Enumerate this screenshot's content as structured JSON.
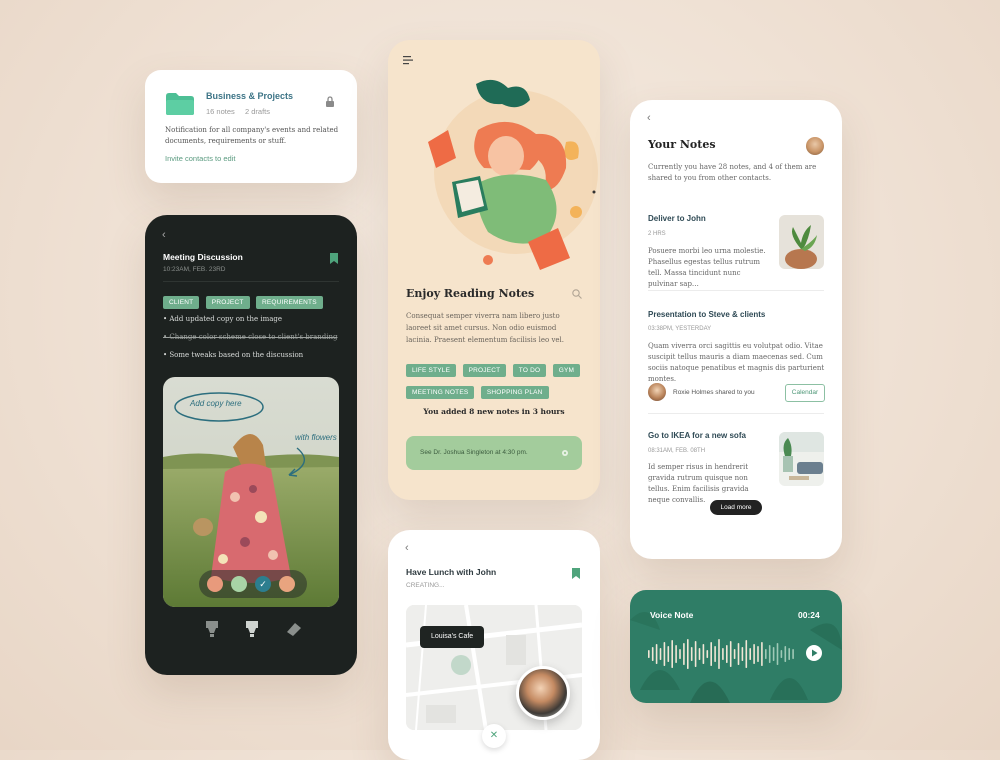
{
  "biz_card": {
    "title": "Business & Projects",
    "notes": "16 notes",
    "drafts": "2 drafts",
    "desc": "Notification for all company's events and related documents, requirements or stuff.",
    "link": "Invite contacts to edit"
  },
  "meeting": {
    "title": "Meeting Discussion",
    "datetime": "10:23AM, FEB. 23RD",
    "tags": [
      "CLIENT",
      "PROJECT",
      "REQUIREMENTS"
    ],
    "items": [
      "Add updated copy on the image",
      "Change color scheme close to client's branding",
      "Some tweaks based on the discussion"
    ],
    "annotation1": "Add copy here",
    "annotation2": "with flowers",
    "swatches": [
      "#e89a7c",
      "#a8d4a6",
      "#2c7e8f",
      "#e9a47f"
    ]
  },
  "reading": {
    "title": "Enjoy Reading Notes",
    "body": "Consequat semper viverra nam libero justo laoreet sit amet cursus. Non odio euismod lacinia. Praesent elementum facilisis leo vel.",
    "tags": [
      "LIFE STYLE",
      "PROJECT",
      "TO DO",
      "GYM",
      "MEETING NOTES",
      "SHOPPING PLAN"
    ],
    "added": "You added 8 new notes in 3 hours",
    "reminder": "See Dr. Joshua Singleton at 4:30 pm."
  },
  "your_notes": {
    "title": "Your Notes",
    "subtitle": "Currently you have 28 notes, and 4 of them are shared to you from other contacts.",
    "notes": [
      {
        "title": "Deliver to John",
        "meta": "2 HRS",
        "body": "Posuere morbi leo urna molestie. Phasellus egestas tellus rutrum tell. Massa tincidunt nunc pulvinar sap…"
      },
      {
        "title": "Presentation to Steve & clients",
        "meta": "03:38PM,  YESTERDAY",
        "body": "Quam viverra orci sagittis eu volutpat odio. Vitae suscipit tellus mauris a diam maecenas sed. Cum sociis natoque penatibus et magnis dis parturient montes."
      },
      {
        "title": "Go to IKEA for a new sofa",
        "meta": "08:31AM,  FEB. 08TH",
        "body": "Id semper risus in hendrerit gravida rutrum quisque non tellus. Enim facilisis gravida neque convallis."
      }
    ],
    "shared": "Roxie Holmes shared to you",
    "calendar": "Calendar",
    "load_more": "Load more"
  },
  "lunch": {
    "title": "Have Lunch with John",
    "status": "CREATING...",
    "place": "Louisa's Cafe"
  },
  "voice": {
    "title": "Voice Note",
    "time": "00:24"
  },
  "colors": {
    "accent": "#6fae8c",
    "dark": "#1d2220",
    "teal": "#2f7d66",
    "title": "#2f4a55"
  }
}
